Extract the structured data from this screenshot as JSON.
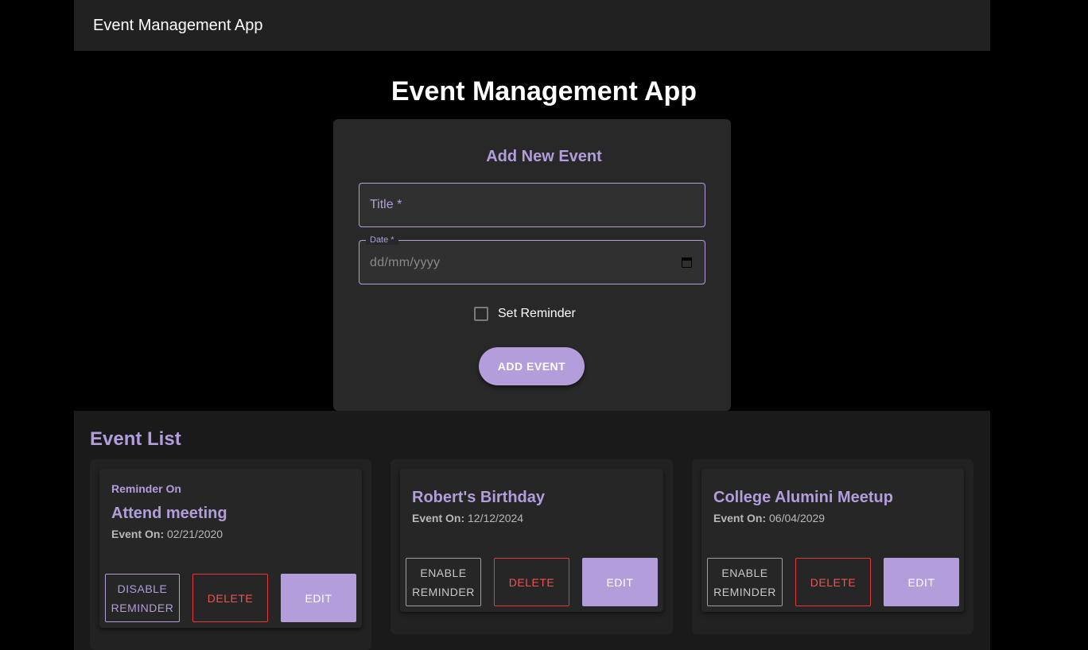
{
  "appbar": {
    "title": "Event Management App"
  },
  "page": {
    "title": "Event Management App"
  },
  "form": {
    "heading": "Add New Event",
    "title_placeholder": "Title *",
    "date_label": "Date *",
    "date_value": "dd/mm/yyyy",
    "reminder_label": "Set Reminder",
    "reminder_checked": false,
    "submit_label": "ADD EVENT"
  },
  "event_list": {
    "heading": "Event List",
    "event_on_label": "Event On:",
    "events": [
      {
        "reminder_badge": "Reminder On",
        "title": "Attend meeting",
        "date": "02/21/2020",
        "reminder_button_line1": "DISABLE",
        "reminder_button_line2": "REMINDER",
        "delete_label": "DELETE",
        "edit_label": "EDIT"
      },
      {
        "title": "Robert's Birthday",
        "date": "12/12/2024",
        "reminder_button_line1": "ENABLE",
        "reminder_button_line2": "REMINDER",
        "delete_label": "DELETE",
        "edit_label": "EDIT"
      },
      {
        "title": "College Alumini Meetup",
        "date": "06/04/2029",
        "reminder_button_line1": "ENABLE",
        "reminder_button_line2": "REMINDER",
        "delete_label": "DELETE",
        "edit_label": "EDIT"
      }
    ]
  },
  "colors": {
    "accent": "#b39ddb",
    "danger": "#e53935",
    "background": "#000000",
    "surface": "#282828"
  },
  "icons": {
    "date_picker": "calendar-icon"
  }
}
